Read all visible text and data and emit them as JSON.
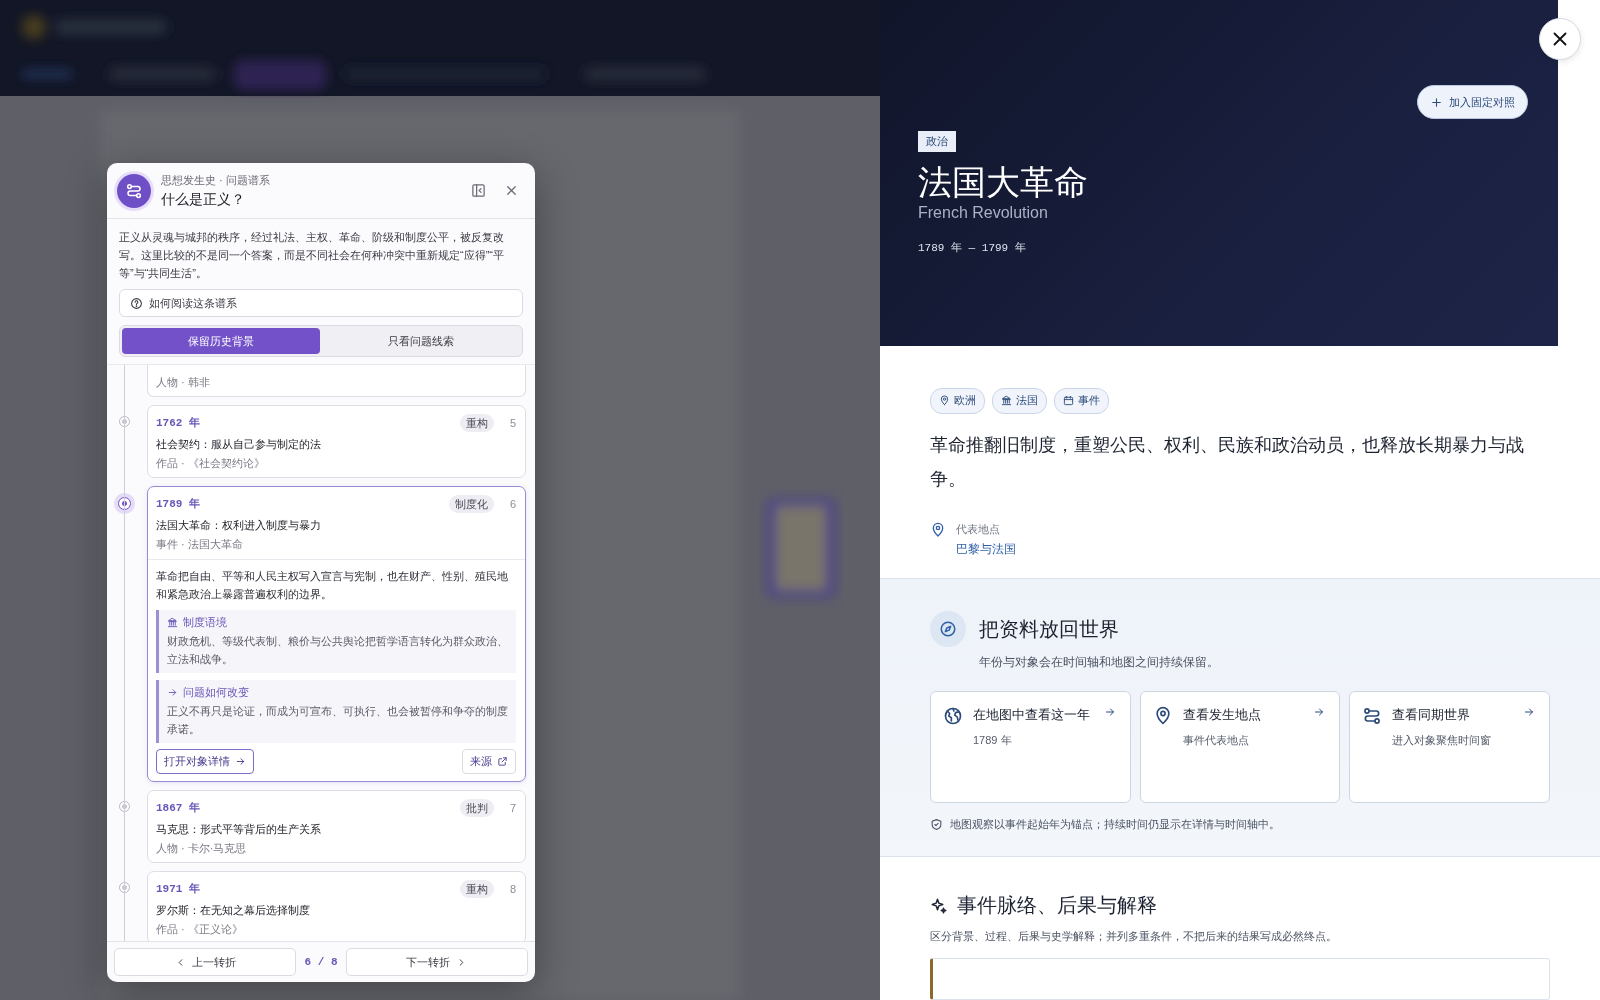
{
  "genealogy_panel": {
    "subtitle": "思想发生史 · 问题谱系",
    "title": "什么是正义？",
    "description": "正义从灵魂与城邦的秩序，经过礼法、主权、革命、阶级和制度公平，被反复改写。这里比较的不是同一个答案，而是不同社会在何种冲突中重新规定“应得”“平等”与“共同生活”。",
    "help": "如何阅读这条谱系",
    "modes": [
      {
        "label": "保留历史背景",
        "selected": true
      },
      {
        "label": "只看问题线索",
        "selected": false
      }
    ],
    "turns": [
      {
        "meta": "人物 · 韩非",
        "selected": false,
        "expanded": false
      },
      {
        "year": "1762 年",
        "tag": "重构",
        "index": "5",
        "title": "社会契约：服从自己参与制定的法",
        "meta": "作品 · 《社会契约论》",
        "selected": false,
        "expanded": false
      },
      {
        "year": "1789 年",
        "tag": "制度化",
        "index": "6",
        "title": "法国大革命：权利进入制度与暴力",
        "meta": "事件 · 法国大革命",
        "selected": true,
        "expanded": true,
        "body": "革命把自由、平等和人民主权写入宣言与宪制，也在财产、性别、殖民地和紧急政治上暴露普遍权利的边界。",
        "notes": [
          {
            "kind": "institution",
            "heading": "制度语境",
            "text": "财政危机、等级代表制、粮价与公共舆论把哲学语言转化为群众政治、立法和战争。"
          },
          {
            "kind": "change",
            "heading": "问题如何改变",
            "text": "正义不再只是论证，而成为可宣布、可执行、也会被暂停和争夺的制度承诺。"
          }
        ],
        "open_button": "打开对象详情",
        "source_button": "来源"
      },
      {
        "year": "1867 年",
        "tag": "批判",
        "index": "7",
        "title": "马克思：形式平等背后的生产关系",
        "meta": "人物 · 卡尔·马克思",
        "selected": false,
        "expanded": false
      },
      {
        "year": "1971 年",
        "tag": "重构",
        "index": "8",
        "title": "罗尔斯：在无知之幕后选择制度",
        "meta": "作品 · 《正义论》",
        "selected": false,
        "expanded": false
      }
    ],
    "prev_button": "上一转折",
    "position": "6 / 8",
    "next_button": "下一转折"
  },
  "detail": {
    "category": "政治",
    "title": "法国大革命",
    "subtitle": "French Revolution",
    "dates": "1789 年 — 1799 年",
    "pin_button": "加入固定对照",
    "tags": [
      {
        "kind": "region",
        "label": "欧洲"
      },
      {
        "kind": "country",
        "label": "法国"
      },
      {
        "kind": "type",
        "label": "事件"
      }
    ],
    "summary": "革命推翻旧制度，重塑公民、权利、民族和政治动员，也释放长期暴力与战争。",
    "location_label": "代表地点",
    "location": "巴黎与法国"
  },
  "world_section": {
    "title": "把资料放回世界",
    "subtitle": "年份与对象会在时间轴和地图之间持续保留。",
    "actions": [
      {
        "kind": "map",
        "title": "在地图中查看这一年",
        "detail": "1789 年"
      },
      {
        "kind": "place",
        "title": "查看发生地点",
        "detail": "事件代表地点"
      },
      {
        "kind": "synchronic",
        "title": "查看同期世界",
        "detail": "进入对象聚焦时间窗"
      }
    ],
    "note": "地图观察以事件起始年为锚点；持续时间仍显示在详情与时间轴中。"
  },
  "context_section": {
    "title": "事件脉络、后果与解释",
    "subtitle": "区分背景、过程、后果与史学解释；并列多重条件，不把后来的结果写成必然终点。"
  }
}
